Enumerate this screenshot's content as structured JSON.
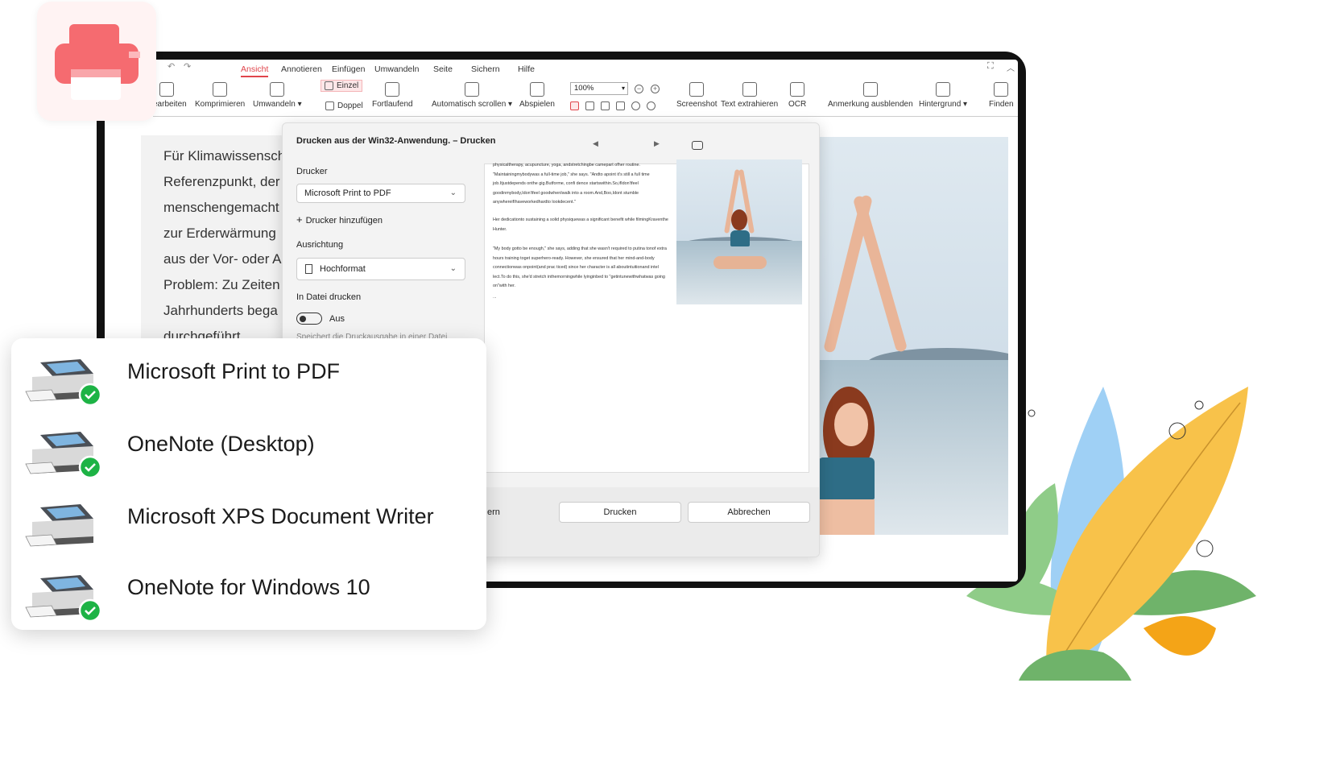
{
  "app": {
    "menu_tabs": [
      "Ansicht",
      "Annotieren",
      "Einfügen",
      "Umwandeln",
      "Seite",
      "Sichern",
      "Hilfe"
    ],
    "toolbar": {
      "bearbeiten": "earbeiten",
      "komprimieren": "Komprimieren",
      "umwandeln": "Umwandeln ▾",
      "einzel": "Einzel",
      "doppel": "Doppel",
      "fortlaufend": "Fortlaufend",
      "auto_scroll": "Automatisch scrollen ▾",
      "abspielen": "Abspielen",
      "zoom": "100%",
      "screenshot": "Screenshot",
      "text_extrahieren": "Text extrahieren",
      "ocr": "OCR",
      "anmerkung": "Anmerkung ausblenden",
      "hintergrund": "Hintergrund ▾",
      "finden": "Finden"
    }
  },
  "document": {
    "lines": [
      "Für Klimawissensch",
      "Referenzpunkt, der",
      "menschengemacht",
      "zur Erderwärmung",
      "aus der Vor- oder A",
      "Problem: Zu Zeiten",
      "Jahrhunderts bega",
      "durchgeführt"
    ]
  },
  "dialog": {
    "title": "Drucken aus der Win32-Anwendung. – Drucken",
    "printer_label": "Drucker",
    "printer_value": "Microsoft Print to PDF",
    "add_printer": "Drucker hinzufügen",
    "orientation_label": "Ausrichtung",
    "orientation_value": "Hochformat",
    "print_to_file_label": "In Datei drucken",
    "toggle_state": "Aus",
    "save_hint": "Speichert die Druckausgabe in einer Datei",
    "footer_partial": "ern",
    "print_button": "Drucken",
    "cancel_button": "Abbrechen",
    "preview_paragraphs": [
      "physicaltherapy, acupuncture, yoga, andstretchingbe camepart ofher routine. \"Maintainingmybodywas a full-time job,\" she says. \"Andto apoint it's still a full time job.Itjustdepends onthe gig.Butforme, confi dence startswithin.So,ifIdon'tfeel goodinmybody,Idon'tfeel goodwhenIwalk into a room.And,Boo,Idont stumble anywhereifIhaveworkedhardto lookdecent.\"",
      "Her dedicationto sustaining a solid physiquewas a significant benefit while filmingKraventhe Hunter.",
      "\"My body gotto be enough,\" she says, adding that she wasn't required to putina tonof extra hours training toget superhero-ready. However, she ensured that her mind-and-body connectionwas onpoint(and prac ticed) since her character is all aboutintuitionand intel lect.To do this, she'd stretch inthemorningwhile lyinginbed to \"getintunewithwhatwas going on\"with her.",
      "..."
    ]
  },
  "printers": [
    {
      "name": "Microsoft Print to PDF",
      "checked": true
    },
    {
      "name": "OneNote (Desktop)",
      "checked": true
    },
    {
      "name": "Microsoft XPS Document Writer",
      "checked": false
    },
    {
      "name": "OneNote for Windows 10",
      "checked": true
    }
  ],
  "colors": {
    "accent": "#e0454c",
    "check_green": "#1db345",
    "leaf_yellow": "#f8c24a",
    "leaf_blue": "#9fd0f5",
    "leaf_green": "#6fb36a"
  }
}
